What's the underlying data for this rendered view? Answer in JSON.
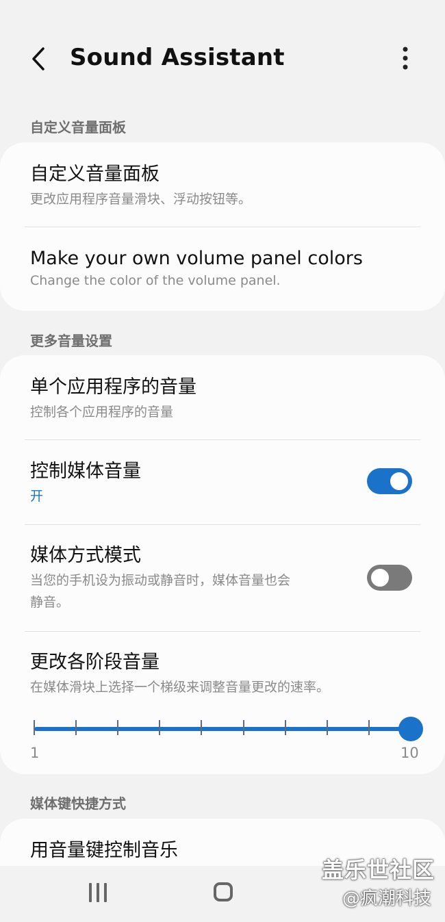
{
  "header": {
    "title": "Sound Assistant",
    "back_icon": "chevron-left-icon",
    "more_icon": "more-vertical-icon"
  },
  "sections": [
    {
      "label": "自定义音量面板",
      "items": [
        {
          "title": "自定义音量面板",
          "subtitle": "更改应用程序音量滑块、浮动按钮等。"
        },
        {
          "title": "Make your own volume panel colors",
          "subtitle": "Change the color of the volume panel."
        }
      ]
    },
    {
      "label": "更多音量设置",
      "items": [
        {
          "title": "单个应用程序的音量",
          "subtitle": "控制各个应用程序的音量"
        },
        {
          "title": "控制媒体音量",
          "subtitle": "开",
          "toggle": true
        },
        {
          "title": "媒体方式模式",
          "subtitle_line1": "当您的手机设为振动或静音时，媒体音量也会",
          "subtitle_line2": "静音。",
          "toggle": false
        },
        {
          "title": "更改各阶段音量",
          "subtitle": "在媒体滑块上选择一个梯级来调整音量更改的速率。",
          "slider": {
            "min_label": "1",
            "max_label": "10",
            "min": 1,
            "max": 10,
            "value": 10
          }
        }
      ]
    },
    {
      "label": "媒体键快捷方式",
      "items": [
        {
          "title": "用音量键控制音乐"
        }
      ]
    }
  ],
  "watermark": {
    "line1": "盖乐世社区",
    "line2": "@疯潮科技"
  },
  "navbar": {
    "recent_icon": "recent-apps-icon",
    "home_icon": "home-icon"
  },
  "colors": {
    "accent": "#1a73c8",
    "background": "#f2f2f2",
    "card": "#fcfcfc"
  }
}
